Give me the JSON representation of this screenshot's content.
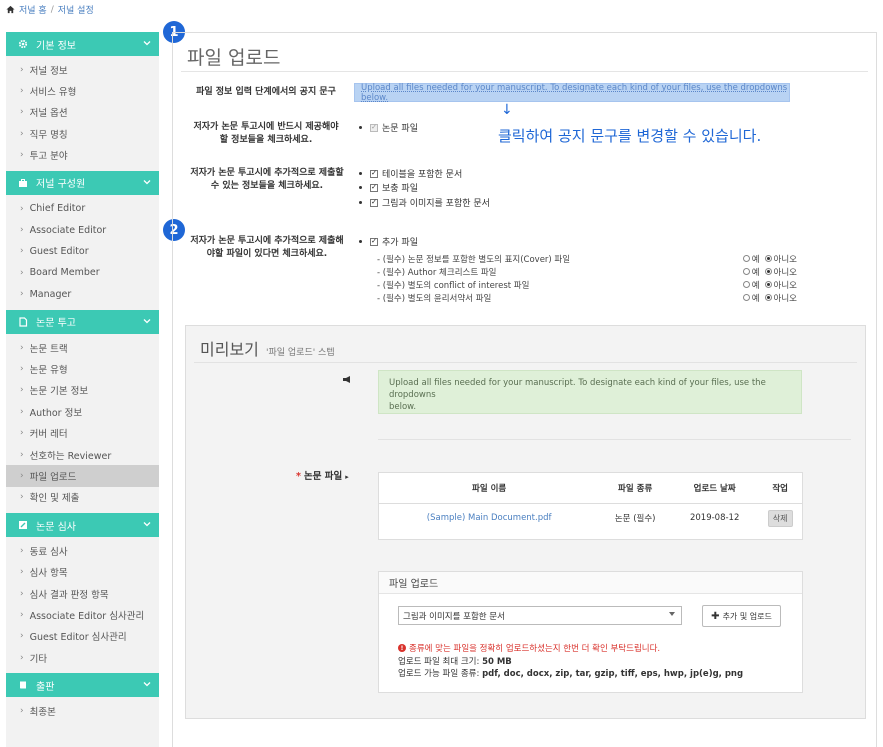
{
  "breadcrumb": {
    "home": "저널 홈",
    "separator": "/",
    "current": "저널 설정"
  },
  "badges": {
    "one": "1",
    "two": "2"
  },
  "sidebar": {
    "sections": [
      {
        "title": "기본 정보",
        "icon": "gear-icon",
        "items": [
          "저널 정보",
          "서비스 유형",
          "저널 옵션",
          "직무 명칭",
          "투고 분야"
        ]
      },
      {
        "title": "저널 구성원",
        "icon": "briefcase-icon",
        "items": [
          "Chief Editor",
          "Associate Editor",
          "Guest Editor",
          "Board Member",
          "Manager"
        ]
      },
      {
        "title": "논문 투고",
        "icon": "document-icon",
        "items": [
          "논문 트랙",
          "논문 유형",
          "논문 기본 정보",
          "Author 정보",
          "커버 레터",
          "선호하는 Reviewer",
          "파일 업로드",
          "확인 및 제출"
        ],
        "active": "파일 업로드"
      },
      {
        "title": "논문 심사",
        "icon": "edit-icon",
        "items": [
          "동료 심사",
          "심사 항목",
          "심사 결과 판정 항목",
          "Associate Editor 심사관리",
          "Guest Editor 심사관리",
          "기타"
        ]
      },
      {
        "title": "출판",
        "icon": "book-icon",
        "items": [
          "최종본"
        ]
      }
    ]
  },
  "main": {
    "title": "파일 업로드",
    "notice_label": "파일 정보 입력 단계에서의 공지 문구",
    "notice_value": "Upload all files needed for your manuscript. To designate each kind of your files, use the dropdowns below.",
    "callout_arrow": "↓",
    "callout_text": "클릭하여 공지 문구를 변경할 수 있습니다.",
    "required_label_1": "저자가 논문 투고시에 반드시 제공해야",
    "required_label_2": "할 정보들을 체크하세요.",
    "required_items": [
      "논문 파일"
    ],
    "optional_label_1": "저자가 논문 투고시에 추가적으로 제출할",
    "optional_label_2": "수 있는 정보들을 체크하세요.",
    "optional_items": [
      "테이블을 포함한 문서",
      "보충 파일",
      "그림과 이미지를 포함한 문서"
    ],
    "extra_label_1": "저자가 논문 투고시에 추가적으로 제출해",
    "extra_label_2": "야할 파일이 있다면 체크하세요.",
    "extra_item": "추가 파일",
    "extra_rows": [
      {
        "label": "- (필수) 논문 정보를 포함한 별도의 표지(Cover) 파일",
        "yes": "예",
        "no": "아니오"
      },
      {
        "label": "- (필수) Author 체크리스트 파일",
        "yes": "예",
        "no": "아니오"
      },
      {
        "label": "- (필수) 별도의 conflict of interest 파일",
        "yes": "예",
        "no": "아니오"
      },
      {
        "label": "- (필수) 별도의 윤리서약서 파일",
        "yes": "예",
        "no": "아니오"
      }
    ]
  },
  "preview": {
    "title": "미리보기",
    "subtitle": "'파일 업로드' 스텝",
    "notice_line_1": "Upload all files needed for your manuscript. To designate each kind of your files, use the dropdowns",
    "notice_line_2": "below.",
    "field_required_mark": "*",
    "field_label": "논문 파일",
    "table": {
      "headers": [
        "파일 이름",
        "파일 종류",
        "업로드 날짜",
        "작업"
      ],
      "rows": [
        {
          "name": "(Sample) Main Document.pdf",
          "type": "논문 (필수)",
          "date": "2019-08-12",
          "action": "삭제"
        }
      ]
    },
    "upload": {
      "header": "파일 업로드",
      "selected": "그림과 이미지를 포함한 문서",
      "add_button": "추가 및 업로드",
      "warning": "종류에 맞는 파일을 정확히 업로드하셨는지 한번 더 확인 부탁드립니다.",
      "max_size_label": "업로드 파일 최대 크기: ",
      "max_size_value": "50 MB",
      "types_label": "업로드 가능 파일 종류: ",
      "types_value": "pdf, doc, docx, zip, tar, gzip, tiff, eps, hwp, jp(e)g, png"
    }
  }
}
